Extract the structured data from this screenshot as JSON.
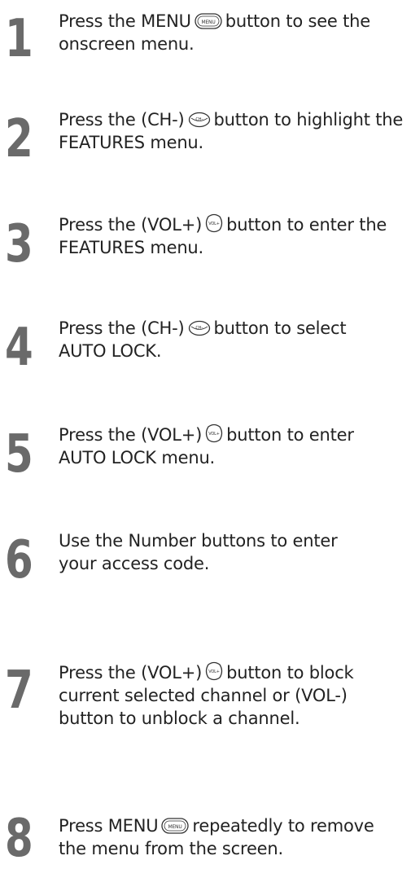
{
  "icons": {
    "menu_button": "menu-button-icon",
    "ch_minus_button": "ch-minus-button-icon",
    "vol_plus_button": "vol-plus-button-icon"
  },
  "icon_labels": {
    "menu": "MENU",
    "ch_minus": "CH–",
    "vol_plus": "VOL+"
  },
  "steps": [
    {
      "number": "1",
      "line1_before": "Press the MENU",
      "line1_after": "button to see the",
      "line2": "onscreen menu."
    },
    {
      "number": "2",
      "line1_before": "Press the (CH-)",
      "line1_after": "button to highlight the",
      "line2": "FEATURES menu."
    },
    {
      "number": "3",
      "line1_before": "Press the (VOL+)",
      "line1_after": "button to enter the",
      "line2": "FEATURES menu."
    },
    {
      "number": "4",
      "line1_before": "Press the (CH-)",
      "line1_after": "button to select",
      "line2": "AUTO LOCK."
    },
    {
      "number": "5",
      "line1_before": "Press the (VOL+)",
      "line1_after": "button to enter",
      "line2": "AUTO LOCK menu."
    },
    {
      "number": "6",
      "line1": "Use the Number buttons to enter",
      "line2": "your access code."
    },
    {
      "number": "7",
      "line1_before": "Press the (VOL+)",
      "line1_after": "button to block",
      "line2": "current selected channel or (VOL-)",
      "line3": "button to unblock a channel."
    },
    {
      "number": "8",
      "line1_before": "Press MENU",
      "line1_after": "repeatedly to remove",
      "line2": "the menu from the screen."
    }
  ]
}
